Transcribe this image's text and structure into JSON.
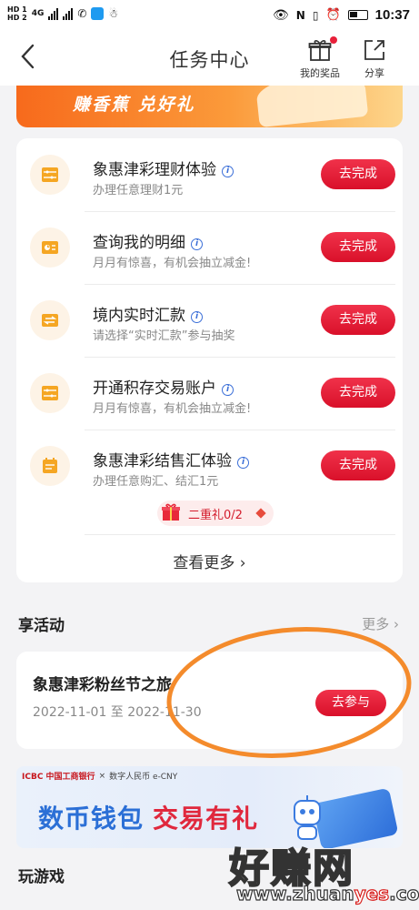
{
  "status_bar": {
    "hd1": "HD 1",
    "hd2": "HD 2",
    "net": "4G",
    "time": "10:37"
  },
  "nav": {
    "title": "任务中心",
    "prizes_label": "我的奖品",
    "share_label": "分享"
  },
  "banner": {
    "text": "赚香蕉 兑好礼"
  },
  "tasks": [
    {
      "title": "象惠津彩理财体验",
      "subtitle": "办理任意理财1元",
      "button": "去完成"
    },
    {
      "title": "查询我的明细",
      "subtitle": "月月有惊喜，有机会抽立减金!",
      "button": "去完成"
    },
    {
      "title": "境内实时汇款",
      "subtitle": "请选择“实时汇款”参与抽奖",
      "button": "去完成"
    },
    {
      "title": "开通积存交易账户",
      "subtitle": "月月有惊喜，有机会抽立减金!",
      "button": "去完成"
    },
    {
      "title": "象惠津彩结售汇体验",
      "subtitle": "办理任意购汇、结汇1元",
      "button": "去完成"
    }
  ],
  "gift": {
    "label": "二重礼0/2"
  },
  "see_more": "查看更多",
  "activities_section": {
    "title": "享活动",
    "more": "更多"
  },
  "activity": {
    "title": "象惠津彩粉丝节之旅",
    "date": "2022-11-01 至 2022-11-30",
    "button": "去参与"
  },
  "ad": {
    "bank": "ICBC 中国工商银行",
    "partner": "数字人民币 e-CNY",
    "headline_1": "数币钱包",
    "headline_2": "交易有礼"
  },
  "games_section": {
    "title": "玩游戏"
  },
  "watermark": {
    "big": "好赚网",
    "url_prefix": "www.zhuan",
    "url_highlight": "yes",
    "url_suffix": ".com"
  },
  "colors": {
    "accent_red": "#e0203a",
    "annotation_orange": "#f48b2c",
    "icon_orange": "#f5a623"
  }
}
